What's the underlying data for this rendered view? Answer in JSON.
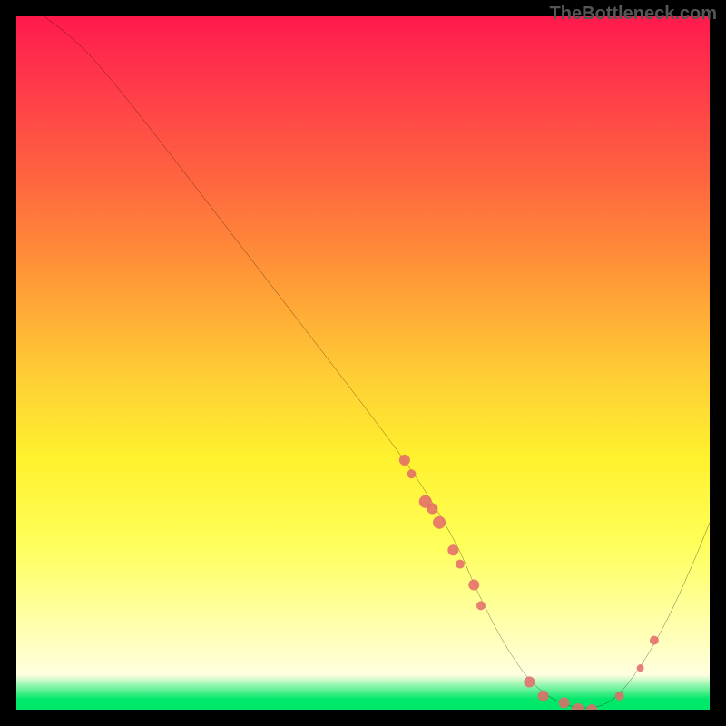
{
  "watermark": "TheBottleneck.com",
  "chart_data": {
    "type": "line",
    "title": "",
    "xlabel": "",
    "ylabel": "",
    "xlim": [
      0,
      100
    ],
    "ylim": [
      0,
      100
    ],
    "grid": false,
    "legend": false,
    "series": [
      {
        "name": "curve",
        "x": [
          4,
          8,
          12,
          20,
          30,
          40,
          50,
          56,
          60,
          64,
          66,
          70,
          74,
          78,
          82,
          86,
          90,
          94,
          98,
          100
        ],
        "values": [
          100,
          97,
          93,
          83,
          70,
          57,
          44,
          36,
          30,
          23,
          18,
          10,
          4,
          1,
          0,
          1,
          6,
          13,
          22,
          27
        ]
      }
    ],
    "markers": [
      {
        "x": 56,
        "y": 36,
        "r": 6
      },
      {
        "x": 57,
        "y": 34,
        "r": 5
      },
      {
        "x": 59,
        "y": 30,
        "r": 7
      },
      {
        "x": 60,
        "y": 29,
        "r": 6
      },
      {
        "x": 61,
        "y": 27,
        "r": 7
      },
      {
        "x": 63,
        "y": 23,
        "r": 6
      },
      {
        "x": 64,
        "y": 21,
        "r": 5
      },
      {
        "x": 66,
        "y": 18,
        "r": 6
      },
      {
        "x": 67,
        "y": 15,
        "r": 5
      },
      {
        "x": 74,
        "y": 4,
        "r": 6
      },
      {
        "x": 76,
        "y": 2,
        "r": 6
      },
      {
        "x": 79,
        "y": 1,
        "r": 6
      },
      {
        "x": 81,
        "y": 0,
        "r": 7
      },
      {
        "x": 83,
        "y": 0,
        "r": 6
      },
      {
        "x": 87,
        "y": 2,
        "r": 5
      },
      {
        "x": 90,
        "y": 6,
        "r": 4
      },
      {
        "x": 92,
        "y": 10,
        "r": 5
      }
    ]
  }
}
